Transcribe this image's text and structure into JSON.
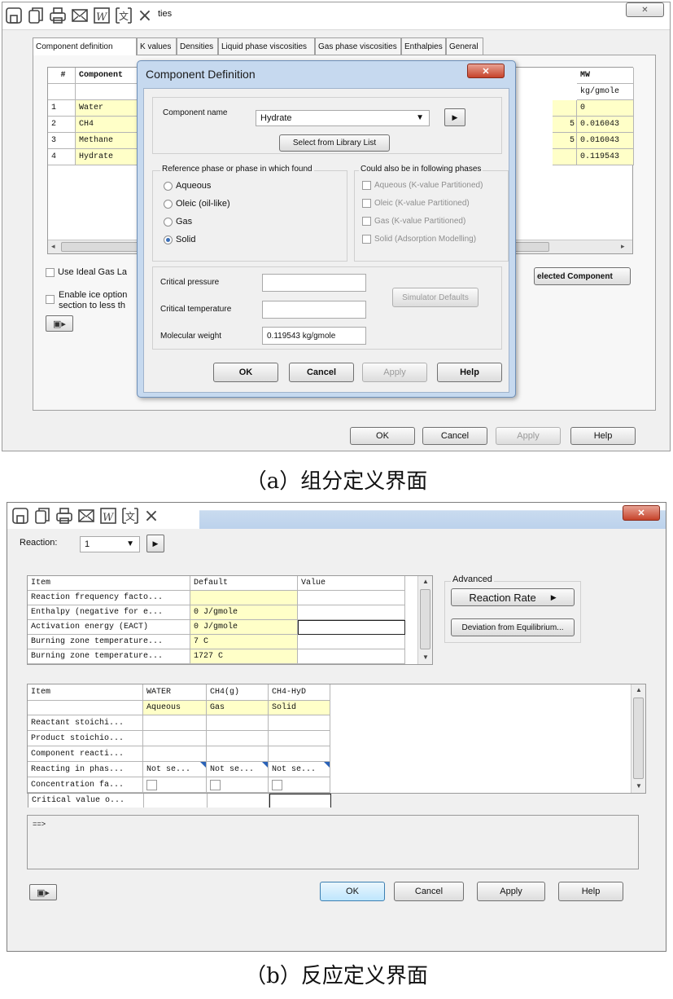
{
  "toolbar_icons": [
    "save-icon",
    "copy-icon",
    "print-icon",
    "email-icon",
    "word-export-icon",
    "translate-icon",
    "close-icon"
  ],
  "top": {
    "window_title": "ties",
    "close_glyph": "×",
    "tabs": [
      "Component definition",
      "K values",
      "Densities",
      "Liquid phase viscosities",
      "Gas phase viscosities",
      "Enthalpies",
      "General"
    ],
    "grid": {
      "col_hash": "#",
      "col_component": "Component",
      "col_mw": "MW",
      "mw_unit": "kg/gmole",
      "rows": [
        {
          "n": "1",
          "name": "Water",
          "mw": "0"
        },
        {
          "n": "2",
          "name": "CH4",
          "mw": "0.016043"
        },
        {
          "n": "3",
          "name": "Methane",
          "mw": "0.016043"
        },
        {
          "n": "4",
          "name": "Hydrate",
          "mw": "0.119543"
        }
      ],
      "stray": [
        "5",
        "5"
      ]
    },
    "use_ideal_gas": "Use Ideal Gas La",
    "enable_ice_1": "Enable ice option",
    "enable_ice_2": "section to less th",
    "selected_component_btn": "elected Component",
    "ok": "OK",
    "cancel": "Cancel",
    "apply": "Apply",
    "help": "Help"
  },
  "dialog": {
    "title": "Component Definition",
    "component_name_label": "Component name",
    "component_name_value": "Hydrate",
    "select_library": "Select from Library List",
    "ref_phase_label": "Reference phase or phase in which found",
    "phases": [
      {
        "label": "Aqueous",
        "on": false
      },
      {
        "label": "Oleic (oil-like)",
        "on": false
      },
      {
        "label": "Gas",
        "on": false
      },
      {
        "label": "Solid",
        "on": true
      }
    ],
    "also_label": "Could also be in following phases",
    "also": [
      "Aqueous (K-value Partitioned)",
      "Oleic (K-value Partitioned)",
      "Gas (K-value Partitioned)",
      "Solid (Adsorption Modelling)"
    ],
    "critical_pressure": "Critical pressure",
    "critical_temperature": "Critical temperature",
    "molecular_weight": "Molecular weight",
    "molecular_weight_value": "0.119543 kg/gmole",
    "simulator_defaults": "Simulator Defaults",
    "ok": "OK",
    "cancel": "Cancel",
    "apply": "Apply",
    "help": "Help"
  },
  "caption_a": "（a）组分定义界面",
  "bottom": {
    "close_glyph": "×",
    "reaction_label": "Reaction:",
    "reaction_value": "1",
    "advanced_label": "Advanced",
    "reaction_rate_btn": "Reaction Rate",
    "deviation_btn": "Deviation from Equilibrium...",
    "table1": {
      "headers": [
        "Item",
        "Default",
        "Value"
      ],
      "rows": [
        {
          "item": "Reaction frequency facto...",
          "default": "",
          "value": ""
        },
        {
          "item": "Enthalpy (negative for e...",
          "default": "0 J/gmole",
          "value": ""
        },
        {
          "item": "Activation energy (EACT)",
          "default": "0 J/gmole",
          "value": ""
        },
        {
          "item": "Burning zone temperature...",
          "default": "7 C",
          "value": ""
        },
        {
          "item": "Burning zone temperature...",
          "default": "1727 C",
          "value": ""
        }
      ]
    },
    "table2": {
      "headers": [
        "Item",
        "WATER",
        "CH4(g)",
        "CH4-HyD"
      ],
      "phases": [
        "",
        "Aqueous",
        "Gas",
        "Solid"
      ],
      "rows": [
        {
          "item": "Reactant stoichi...",
          "cells": [
            "",
            "",
            ""
          ]
        },
        {
          "item": "Product stoichio...",
          "cells": [
            "",
            "",
            ""
          ]
        },
        {
          "item": "Component reacti...",
          "cells": [
            "",
            "",
            ""
          ]
        },
        {
          "item": "Reacting in phas...",
          "cells": [
            "Not se...",
            "Not se...",
            "Not se..."
          ]
        },
        {
          "item": "Concentration fa...",
          "cells": [
            "",
            "",
            ""
          ]
        },
        {
          "item": "Critical value o...",
          "cells": [
            "",
            "",
            ""
          ]
        }
      ]
    },
    "console_text": "==>",
    "ok": "OK",
    "cancel": "Cancel",
    "apply": "Apply",
    "help": "Help"
  },
  "caption_b": "（b）反应定义界面"
}
